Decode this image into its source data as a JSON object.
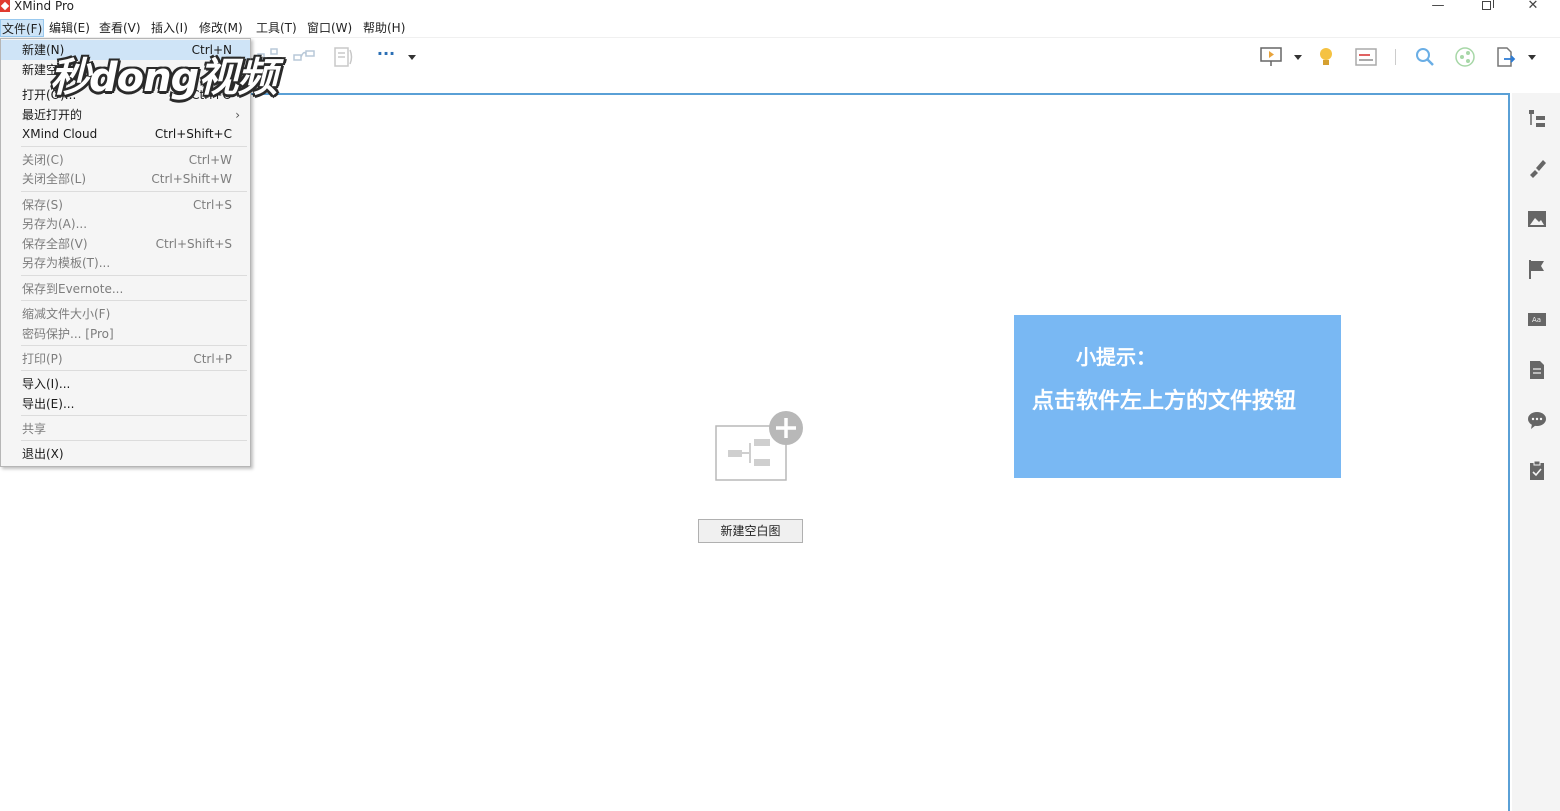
{
  "window": {
    "title": "XMind Pro",
    "controls": {
      "minimize": "—",
      "close": "✕"
    }
  },
  "menubar": {
    "items": [
      "文件(F)",
      "编辑(E)",
      "查看(V)",
      "插入(I)",
      "修改(M)",
      "工具(T)",
      "窗口(W)",
      "帮助(H)"
    ],
    "active_index": 0
  },
  "file_menu": {
    "items": [
      {
        "label": "新建(N)",
        "shortcut": "Ctrl+N",
        "enabled": true,
        "highlight": true
      },
      {
        "label": "新建空",
        "shortcut": "",
        "enabled": true
      },
      {
        "label": "打开(O)...",
        "shortcut": "Ctrl+O",
        "enabled": true
      },
      {
        "label": "最近打开的",
        "shortcut": "",
        "enabled": true,
        "submenu": true
      },
      {
        "label": "XMind Cloud",
        "shortcut": "Ctrl+Shift+C",
        "enabled": true
      },
      {
        "label": "关闭(C)",
        "shortcut": "Ctrl+W",
        "enabled": false
      },
      {
        "label": "关闭全部(L)",
        "shortcut": "Ctrl+Shift+W",
        "enabled": false
      },
      {
        "label": "保存(S)",
        "shortcut": "Ctrl+S",
        "enabled": false
      },
      {
        "label": "另存为(A)...",
        "shortcut": "",
        "enabled": false
      },
      {
        "label": "保存全部(V)",
        "shortcut": "Ctrl+Shift+S",
        "enabled": false
      },
      {
        "label": "另存为模板(T)...",
        "shortcut": "",
        "enabled": false
      },
      {
        "label": "保存到Evernote...",
        "shortcut": "",
        "enabled": false
      },
      {
        "label": "缩减文件大小(F)",
        "shortcut": "",
        "enabled": false
      },
      {
        "label": "密码保护... [Pro]",
        "shortcut": "",
        "enabled": false
      },
      {
        "label": "打印(P)",
        "shortcut": "Ctrl+P",
        "enabled": false
      },
      {
        "label": "导入(I)...",
        "shortcut": "",
        "enabled": true
      },
      {
        "label": "导出(E)...",
        "shortcut": "",
        "enabled": true
      },
      {
        "label": "共享",
        "shortcut": "",
        "enabled": false
      },
      {
        "label": "退出(X)",
        "shortcut": "",
        "enabled": true
      }
    ],
    "submenu_arrow": "›"
  },
  "watermark": {
    "text": "秒dong视频"
  },
  "toolbar": {
    "more_label": "···",
    "icons": [
      "structure-icon",
      "relationship-icon",
      "boundary-icon",
      "more-icon",
      "presentation-icon",
      "idea-icon",
      "gantt-icon",
      "search-icon",
      "share-icon",
      "export-icon"
    ]
  },
  "canvas": {
    "new_blank_button": "新建空白图",
    "add_icon": "plus-circle-icon"
  },
  "tip": {
    "title": "小提示：",
    "text": "点击软件左上方的文件按钮"
  },
  "sidebar": {
    "icons": [
      "outline-icon",
      "format-icon",
      "image-icon",
      "marker-icon",
      "label-icon",
      "notes-icon",
      "comment-icon",
      "task-icon"
    ]
  },
  "colors": {
    "accent": "#5aa0d6",
    "tip_background": "#79b8f3",
    "menu_highlight": "#cfe4f7",
    "logo_red": "#e03a2f"
  }
}
